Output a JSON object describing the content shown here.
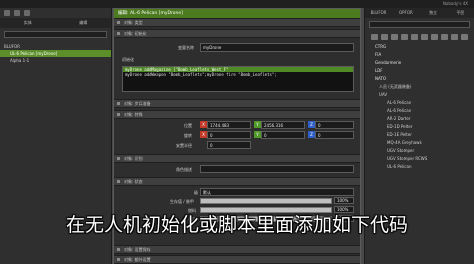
{
  "app": {
    "version_label": "Nobody's 4X"
  },
  "left_panel": {
    "tabs": [
      "实体",
      "编辑"
    ],
    "tree": [
      {
        "label": "BLUFOR"
      },
      {
        "label": "UL-6 Pelican [myDrone]"
      },
      {
        "label": "Alpha 1-1"
      }
    ]
  },
  "right_panel": {
    "tabs": [
      "BLUFOR",
      "OPFOR",
      "独立",
      "平民"
    ],
    "tree": [
      {
        "label": "CTRG"
      },
      {
        "label": "FIA"
      },
      {
        "label": "Gendarmerie"
      },
      {
        "label": "LDF"
      },
      {
        "label": "NATO"
      },
      {
        "label": "人员 (无武器装备)"
      },
      {
        "label": "UAV"
      },
      {
        "label": "AL-6 Pelican"
      },
      {
        "label": "AL-6 Pelican"
      },
      {
        "label": "AR-2 Darter"
      },
      {
        "label": "ED-1D Pelter"
      },
      {
        "label": "ED-1E Pelter"
      },
      {
        "label": "MQ-4A Greyhawk"
      },
      {
        "label": "UGV Stomper"
      },
      {
        "label": "UGV Stomper RCWS"
      },
      {
        "label": "UL-6 Pelican"
      }
    ]
  },
  "dialog": {
    "title": "编辑: AL-6 Pelican [myDrone]",
    "sections": {
      "object_type": "对象: 类型",
      "object_init": "对象: 初始化",
      "object_control": "对象: 步兵准备",
      "object_special": "对象: 特殊",
      "object_transform": "对象: 坐标",
      "object_identity": "对象: 识别",
      "object_state": "对象: 状态",
      "object_special_states": "对象: 设置保存",
      "object_extra": "对象: 额外设置"
    },
    "variable_name_label": "变量名称",
    "variable_name_value": "myDrone",
    "init_label": "初始化",
    "init_code": [
      "myDrone addMagazine [\"Bomb_Leaflets_West_F\"",
      "myDrone addWeapon \"Bomb_Leaflets\";myDrone fire \"Bomb_Leaflets\";"
    ],
    "position_label": "位置",
    "position": {
      "x": "1744.483",
      "y": "2456.316",
      "z": "0"
    },
    "rotation_label": "旋转",
    "rotation": {
      "x": "0",
      "y": "0",
      "z": "0"
    },
    "placement_radius_label": "安置半径",
    "placement_radius": "0",
    "role_label": "角色描述",
    "role_value": "",
    "state_level_label": "级",
    "state_level_value": "默认",
    "health_label": "生存值 / 装甲",
    "health_pct": "100%",
    "fuel_label": "燃料",
    "fuel_pct": "100%",
    "ammo_label": "弹药",
    "ammo_pct": "100%",
    "health_fill": 1.0,
    "fuel_fill": 1.0,
    "ammo_fill": 1.0
  },
  "subtitle": "在无人机初始化或脚本里面添加如下代码",
  "colors": {
    "accent_green": "#4c7a1e",
    "axis_x": "#c23a2a",
    "axis_y": "#4f9a2a",
    "axis_z": "#2f5fc9"
  }
}
